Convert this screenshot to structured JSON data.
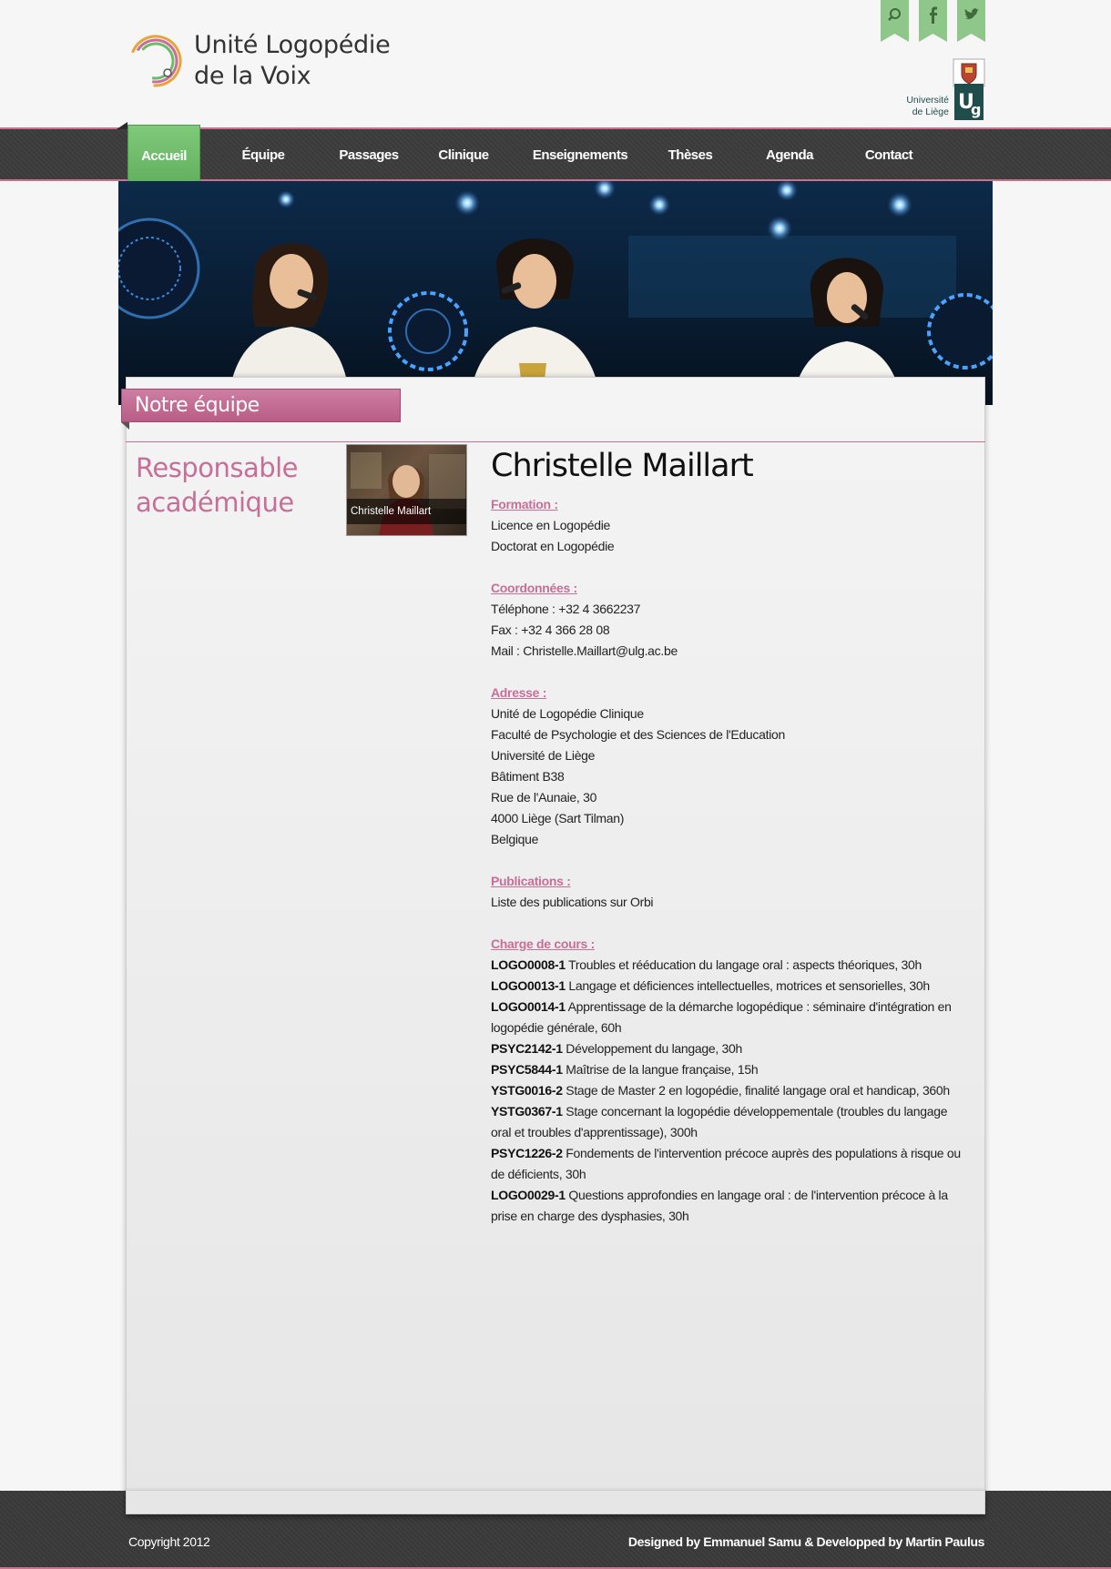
{
  "header": {
    "title_line1": "Unité Logopédie",
    "title_line2": "de la Voix",
    "university_line1": "Université",
    "university_line2": "de Liège",
    "university_mark": "ULg"
  },
  "social": [
    "search-icon",
    "facebook-icon",
    "twitter-icon"
  ],
  "nav": {
    "items": [
      "Accueil",
      "Équipe",
      "Passages",
      "Clinique",
      "Enseignements",
      "Thèses",
      "Agenda",
      "Contact"
    ],
    "active": "Accueil"
  },
  "section": {
    "title": "Notre équipe",
    "role": "Responsable académique"
  },
  "person": {
    "name": "Christelle Maillart",
    "photo_caption": "Christelle Maillart",
    "formation_label": "Formation :",
    "formation": [
      "Licence en Logopédie",
      "Doctorat en Logopédie"
    ],
    "contact_label": "Coordonnées :",
    "phone": "Téléphone : +32 4 3662237",
    "fax": "Fax : +32 4 366 28 08",
    "mail": "Mail : Christelle.Maillart@ulg.ac.be",
    "address_label": "Adresse :",
    "address": [
      "Unité de Logopédie Clinique",
      "Faculté de Psychologie et des Sciences de l'Education",
      "Université de Liège",
      "Bâtiment B38",
      "Rue de l'Aunaie, 30",
      "4000 Liège (Sart Tilman)",
      "Belgique"
    ],
    "publications_label": "Publications :",
    "publications": "Liste des publications sur Orbi",
    "courses_label": "Charge de cours :",
    "courses": [
      {
        "code": "LOGO0008-1",
        "text": " Troubles et rééducation du langage oral : aspects théoriques, 30h"
      },
      {
        "code": "LOGO0013-1",
        "text": " Langage et déficiences intellectuelles, motrices et sensorielles, 30h"
      },
      {
        "code": "LOGO0014-1",
        "text": " Apprentissage de la démarche logopédique : séminaire d'intégration en logopédie générale, 60h"
      },
      {
        "code": "PSYC2142-1",
        "text": " Développement du langage, 30h"
      },
      {
        "code": "PSYC5844-1",
        "text": " Maîtrise de la langue française, 15h"
      },
      {
        "code": "YSTG0016-2",
        "text": " Stage de Master 2 en logopédie, finalité langage oral et handicap, 360h"
      },
      {
        "code": "YSTG0367-1",
        "text": " Stage concernant la logopédie développementale (troubles du langage oral et troubles d'apprentissage), 300h"
      },
      {
        "code": "PSYC1226-2",
        "text": " Fondements de l'intervention précoce auprès des populations à risque ou de déficients, 30h"
      },
      {
        "code": "LOGO0029-1",
        "text": " Questions approfondies en langage oral : de l'intervention précoce à la prise en charge des dysphasies, 30h"
      }
    ]
  },
  "footer": {
    "copyright": "Copyright 2012",
    "credit": "Designed by Emmanuel Samu & Developped by Martin Paulus"
  },
  "colors": {
    "accent_pink": "#c66f98",
    "nav_active_green": "#6dbb69",
    "dark_bar": "#3a3a3a"
  }
}
